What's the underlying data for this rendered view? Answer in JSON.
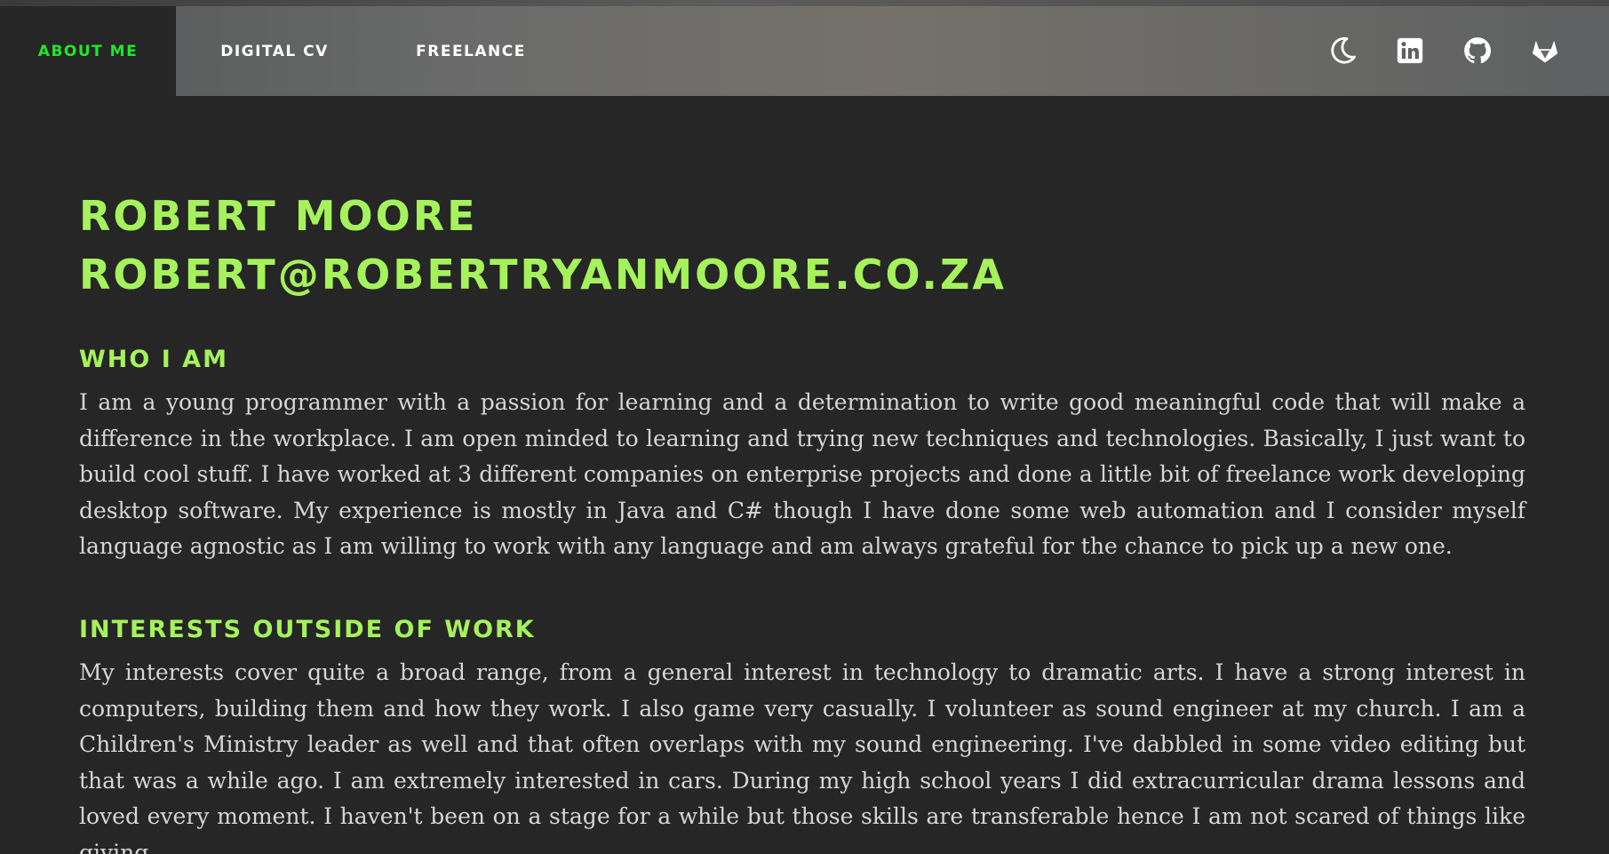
{
  "nav": {
    "tabs": [
      {
        "label": "ABOUT ME",
        "active": true
      },
      {
        "label": "DIGITAL CV",
        "active": false
      },
      {
        "label": "FREELANCE",
        "active": false
      }
    ],
    "icons": [
      "moon-icon",
      "linkedin-icon",
      "github-icon",
      "gitlab-icon"
    ],
    "active_color": "#22e62b"
  },
  "profile": {
    "name": "ROBERT MOORE",
    "email": "ROBERT@ROBERTRYANMOORE.CO.ZA"
  },
  "sections": [
    {
      "title": "WHO I AM",
      "text": "I am a young programmer with a passion for learning and a determination to write good meaningful code that will make a difference in the workplace. I am open minded to learning and trying new techniques and technologies. Basically, I just want to build cool stuff. I have worked at 3 different companies on enterprise projects and done a little bit of freelance work developing desktop software. My experience is mostly in Java and C# though I have done some web automation and I consider myself language agnostic as I am willing to work with any language and am always grateful for the chance to pick up a new one."
    },
    {
      "title": "INTERESTS OUTSIDE OF WORK",
      "text": "My interests cover quite a broad range, from a general interest in technology to dramatic arts. I have a strong interest in computers, building them and how they work. I also game very casually. I volunteer as sound engineer at my church. I am a Children's Ministry leader as well and that often overlaps with my sound engineering. I've dabbled in some video editing but that was a while ago. I am extremely interested in cars. During my high school years I did extracurricular drama lessons and loved every moment. I haven't been on a stage for a while but those skills are transferable hence I am not scared of things like giving"
    }
  ],
  "colors": {
    "background": "#262626",
    "heading": "#a5f25c",
    "body_text": "#d6d6d6"
  }
}
